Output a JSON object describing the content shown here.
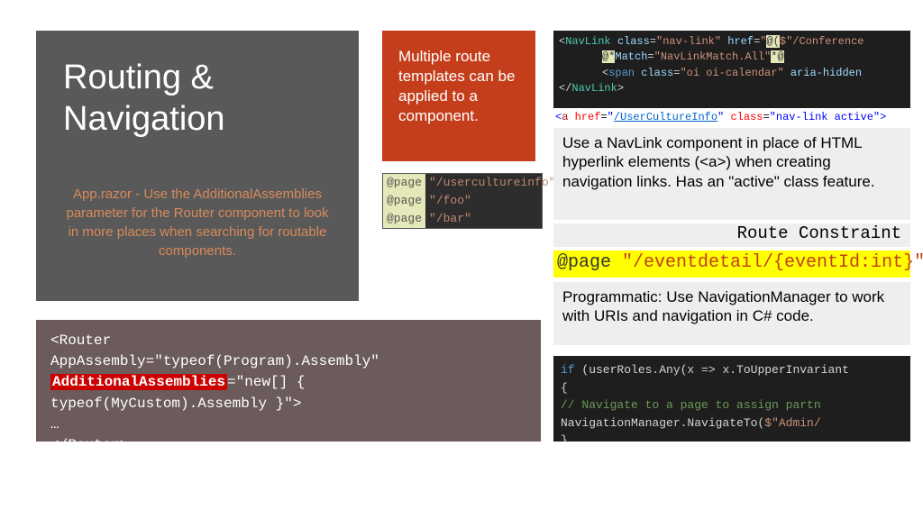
{
  "title": "Routing & Navigation",
  "subtitle": "App.razor - Use the AdditionalAssemblies parameter for the Router component to look in more places when searching for routable components.",
  "redBox": "Multiple route templates can be applied to a component.",
  "pageDirectives": [
    {
      "dir": "@page",
      "path": "\"/usercultureinfo\""
    },
    {
      "dir": "@page",
      "path": "\"/foo\""
    },
    {
      "dir": "@page",
      "path": "\"/bar\""
    }
  ],
  "navlinkCode": {
    "l1a": "<",
    "l1b": "NavLink ",
    "l1c": "class",
    "l1d": "=",
    "l1e": "\"nav-link\" ",
    "l1f": "href",
    "l1g": "=",
    "l1h": "\"",
    "l1i": "@(",
    "l1j": "$\"/Conference",
    "l2a": "@*",
    "l2b": "Match",
    "l2c": "=",
    "l2d": "\"NavLinkMatch.All\"",
    "l2e": "*@",
    "l3a": "<",
    "l3b": "span ",
    "l3c": "class",
    "l3d": "=",
    "l3e": "\"oi oi-calendar\" ",
    "l3f": "aria-hidden",
    "l4a": "</",
    "l4b": "NavLink",
    "l4c": ">"
  },
  "hrefLine": {
    "a": "<",
    "b": "a ",
    "c": "href",
    "d": "=",
    "e": "\"",
    "f": "/UserCultureInfo",
    "g": "\"",
    "h": " class",
    "i": "=",
    "j": "\"nav-link active\"",
    "k": ">"
  },
  "navlinkDesc": "Use a NavLink component in place of HTML hyperlink elements (<a>) when creating navigation links.  Has an \"active\" class feature.",
  "routeConstraint": "Route Constraint",
  "pageHighlight": {
    "dir": "@page ",
    "path": "\"/eventdetail/{eventId:int}\""
  },
  "programmatic": "Programmatic: Use NavigationManager to work with URIs and navigation in C# code.",
  "routerCode": {
    "l1": "<Router",
    "l2": "   AppAssembly=\"typeof(Program).Assembly\"",
    "l3a": "   ",
    "l3b": "AdditionalAssemblies",
    "l3c": "=\"new[] { typeof(MyCustom).Assembly }\">",
    "l4": "   …",
    "l5": "</Router>"
  },
  "navManagerCode": {
    "l1a": "if ",
    "l1b": "(userRoles.Any(x ",
    "l1c": "=>",
    "l1d": " x.ToUpperInvariant",
    "l2": "{",
    "l3": "    // Navigate to a page to assign partn",
    "l4a": "    NavigationManager.NavigateTo(",
    "l4b": "$\"Admin/",
    "l5": "}"
  }
}
